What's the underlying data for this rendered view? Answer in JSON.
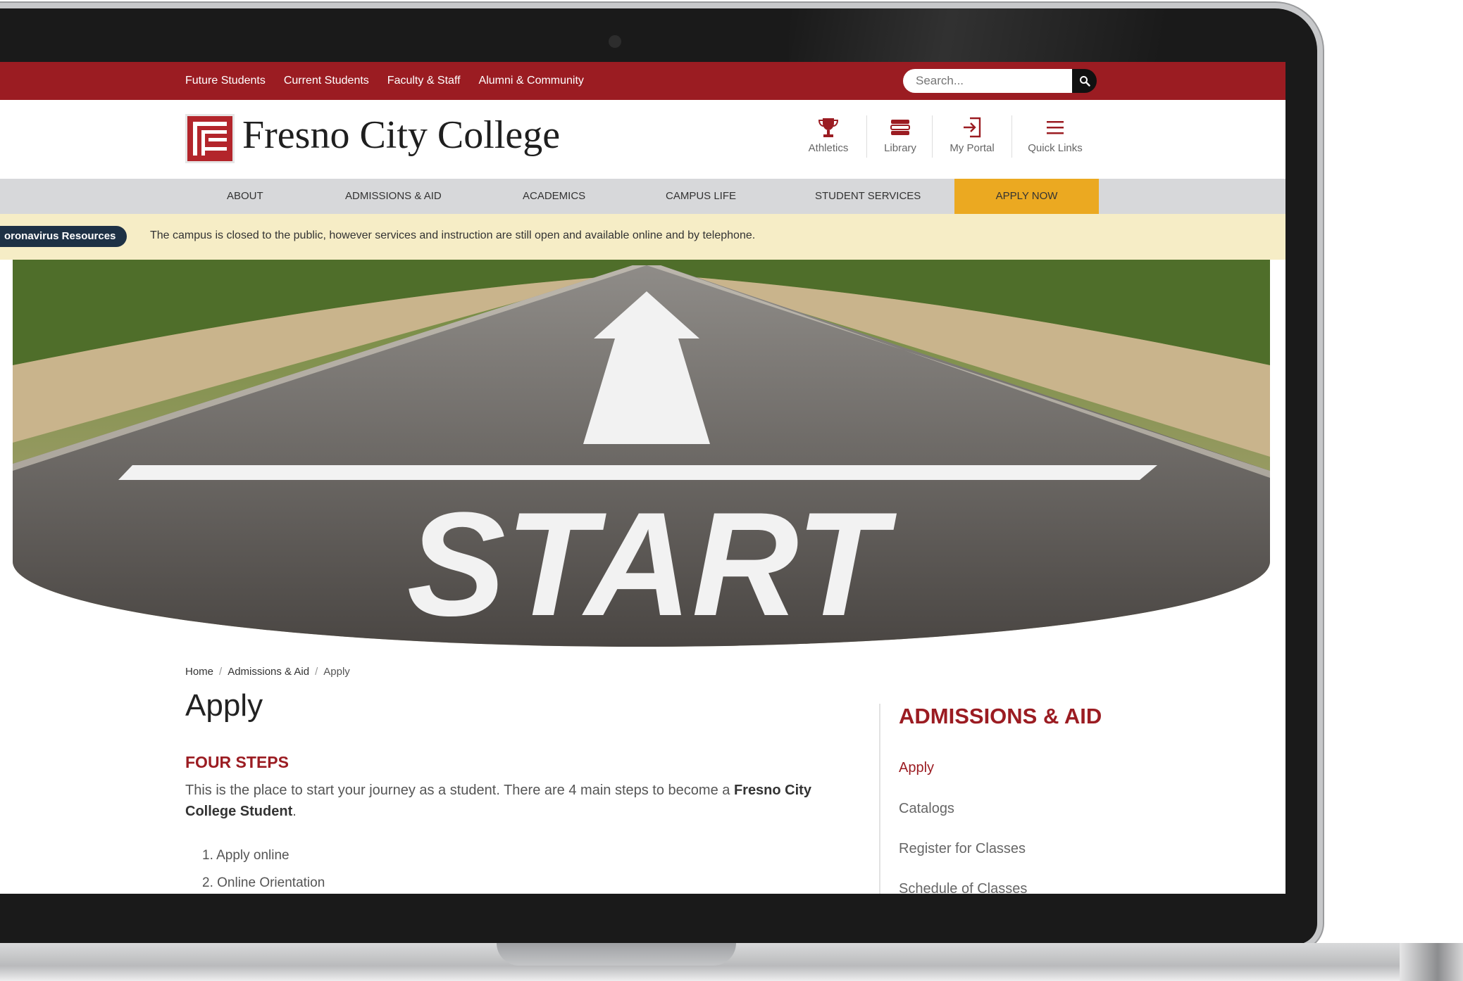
{
  "top_nav": {
    "links": [
      "Future Students",
      "Current Students",
      "Faculty & Staff",
      "Alumni & Community"
    ],
    "search_placeholder": "Search..."
  },
  "header": {
    "college_name": "Fresno City College",
    "quick_links": [
      {
        "label": "Athletics",
        "icon": "trophy-icon"
      },
      {
        "label": "Library",
        "icon": "books-icon"
      },
      {
        "label": "My Portal",
        "icon": "login-icon"
      },
      {
        "label": "Quick Links",
        "icon": "menu-icon"
      }
    ]
  },
  "main_nav": {
    "items": [
      "ABOUT",
      "ADMISSIONS & AID",
      "ACADEMICS",
      "CAMPUS LIFE",
      "STUDENT SERVICES"
    ],
    "cta": "APPLY NOW"
  },
  "alert": {
    "pill": "oronavirus Resources",
    "text": "The campus is closed to the public, however services and instruction are still open and available online and by telephone."
  },
  "hero": {
    "road_text": "START"
  },
  "breadcrumb": [
    "Home",
    "Admissions & Aid",
    "Apply"
  ],
  "content": {
    "page_title": "Apply",
    "section_title": "FOUR STEPS",
    "intro_before": "This is the place to start your journey as a student. There are 4 main steps to become a ",
    "intro_bold": "Fresno City College Student",
    "intro_after": ".",
    "steps": [
      "1. Apply online",
      "2. Online Orientation"
    ]
  },
  "sidebar": {
    "title": "ADMISSIONS & AID",
    "links": [
      "Apply",
      "Catalogs",
      "Register for Classes",
      "Schedule of Classes"
    ]
  },
  "colors": {
    "brand_red": "#9b1c22",
    "apply_gold": "#eba921",
    "nav_gray": "#d7d8da",
    "alert_yellow": "#f6edc6",
    "alert_pill_navy": "#1e3145"
  }
}
